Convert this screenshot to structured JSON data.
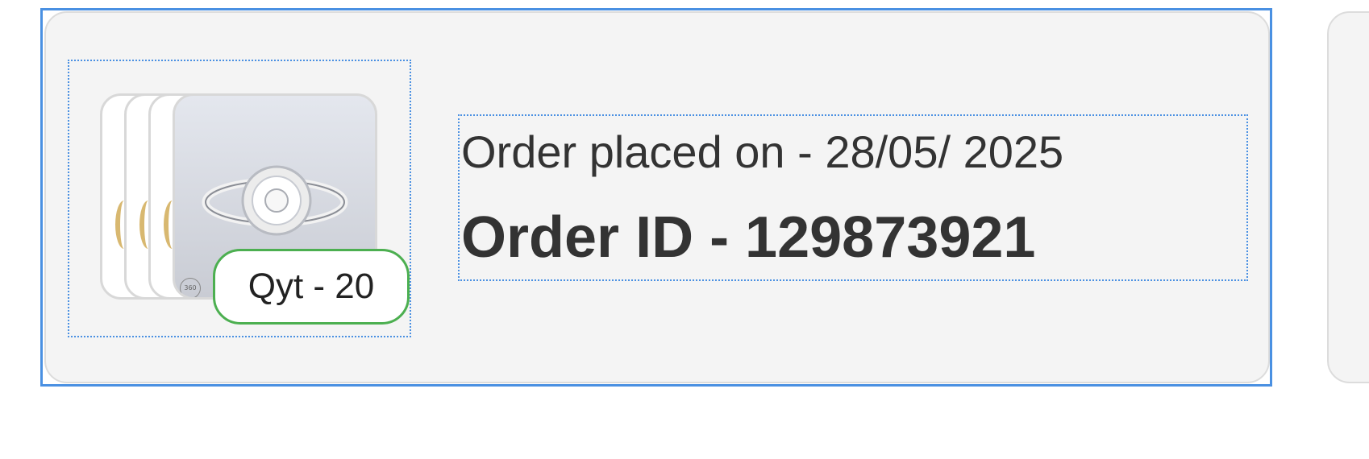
{
  "order": {
    "quantity_label": "Qyt - 20",
    "placed_label": "Order placed on - 28/05/ 2025",
    "order_id_label": "Order ID - 129873921",
    "product_icon": "diamond-ring-image",
    "badge_360": "360"
  },
  "colors": {
    "selection_border": "#4a90e2",
    "card_background": "#f4f4f4",
    "quantity_border": "#4caf50",
    "text": "#333333"
  }
}
